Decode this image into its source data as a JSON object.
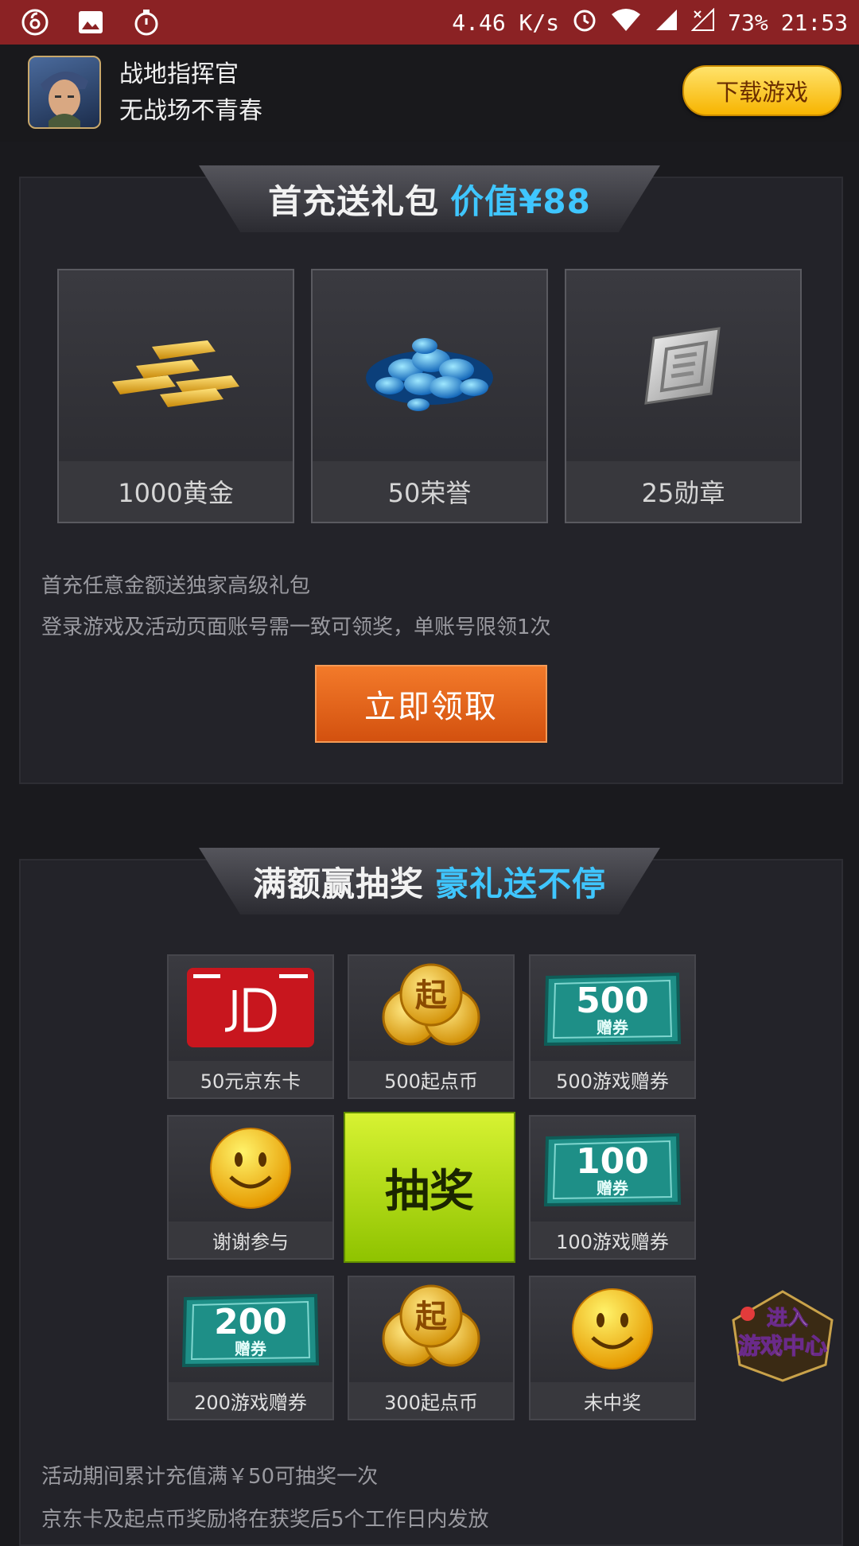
{
  "status_bar": {
    "network_speed": "4.46 K/s",
    "battery": "73%",
    "time": "21:53"
  },
  "app": {
    "name": "战地指挥官",
    "slogan": "无战场不青春",
    "download_label": "下载游戏"
  },
  "first_charge": {
    "banner_title": "首充送礼包",
    "banner_highlight": "价值¥88",
    "gifts": [
      {
        "label": "1000黄金",
        "icon": "gold-bars-icon"
      },
      {
        "label": "50荣誉",
        "icon": "blue-gems-icon"
      },
      {
        "label": "25勋章",
        "icon": "medal-icon"
      }
    ],
    "notes": [
      "首充任意金额送独家高级礼包",
      "登录游戏及活动页面账号需一致可领奖，单账号限领1次"
    ],
    "claim_label": "立即领取"
  },
  "lottery": {
    "banner_title": "满额赢抽奖",
    "banner_highlight": "豪礼送不停",
    "prizes": [
      {
        "label": "50元京东卡",
        "icon": "jd-card-icon"
      },
      {
        "label": "500起点币",
        "icon": "coins-icon"
      },
      {
        "label": "500游戏赠券",
        "icon": "ticket-icon",
        "ticket_value": "500",
        "ticket_text": "赠券"
      },
      {
        "label": "谢谢参与",
        "icon": "smiley-icon"
      },
      {
        "label": "100游戏赠券",
        "icon": "ticket-icon",
        "ticket_value": "100",
        "ticket_text": "赠券"
      },
      {
        "label": "200游戏赠券",
        "icon": "ticket-icon",
        "ticket_value": "200",
        "ticket_text": "赠券"
      },
      {
        "label": "300起点币",
        "icon": "coins-icon"
      },
      {
        "label": "未中奖",
        "icon": "smiley-icon"
      }
    ],
    "draw_label": "抽奖",
    "coin_char": "起",
    "notes": [
      "活动期间累计充值满￥50可抽奖一次",
      "京东卡及起点币奖励将在获奖后5个工作日内发放"
    ]
  },
  "game_center": {
    "line1": "进入",
    "line2": "游戏中心"
  },
  "colors": {
    "status_bar": "#8b2224",
    "accent_blue": "#3fc6ff",
    "claim_orange": "#e4631a",
    "draw_green": "#a6d40a"
  }
}
